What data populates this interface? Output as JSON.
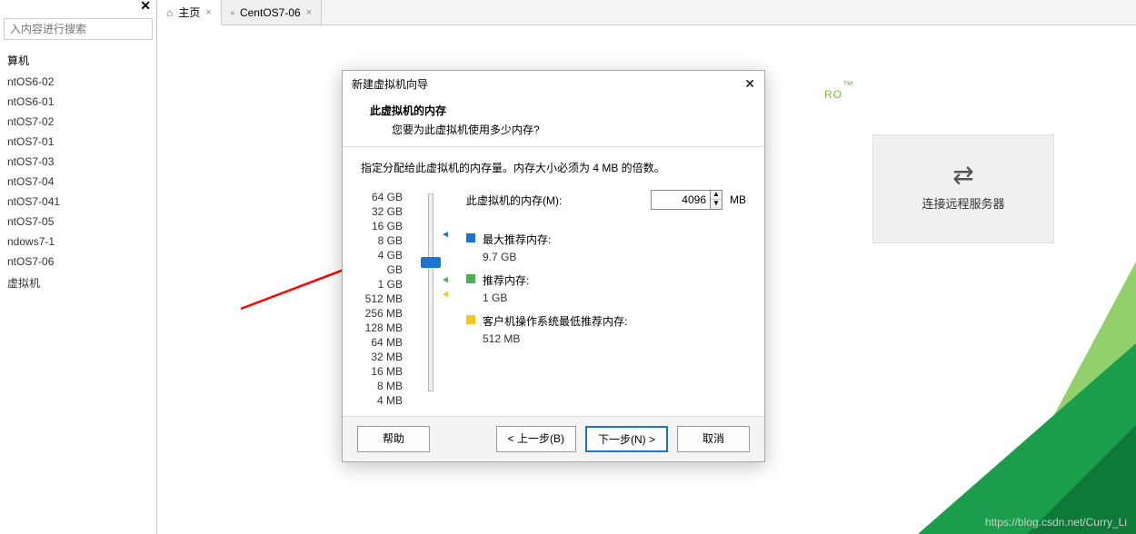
{
  "sidebar": {
    "search_placeholder": "入内容进行搜索",
    "root_label": "算机",
    "items": [
      "ntOS6-02",
      "ntOS6-01",
      "ntOS7-02",
      "ntOS7-01",
      "ntOS7-03",
      "ntOS7-04",
      "ntOS7-041",
      "ntOS7-05",
      "ndows7-1",
      "ntOS7-06",
      "虚拟机"
    ]
  },
  "tabs": {
    "home": "主页",
    "second": "CentOS7-06"
  },
  "brand": "RO",
  "remote_button": "连接远程服务器",
  "dialog": {
    "title": "新建虚拟机向导",
    "heading": "此虚拟机的内存",
    "subheading": "您要为此虚拟机使用多少内存?",
    "instruction": "指定分配给此虚拟机的内存量。内存大小必须为 4 MB 的倍数。",
    "mem_label": "此虚拟机的内存(M):",
    "mem_value": "4096",
    "mem_unit": "MB",
    "ticks": [
      "64 GB",
      "32 GB",
      "16 GB",
      "8 GB",
      "4 GB",
      "GB",
      "1 GB",
      "512 MB",
      "256 MB",
      "128 MB",
      "64 MB",
      "32 MB",
      "16 MB",
      "8 MB",
      "4 MB"
    ],
    "legend": {
      "max_label": "最大推荐内存:",
      "max_value": "9.7 GB",
      "rec_label": "推荐内存:",
      "rec_value": "1 GB",
      "min_label": "客户机操作系统最低推荐内存:",
      "min_value": "512 MB"
    },
    "buttons": {
      "help": "帮助",
      "back": "< 上一步(B)",
      "next": "下一步(N) >",
      "cancel": "取消"
    }
  },
  "watermark": "https://blog.csdn.net/Curry_Li"
}
